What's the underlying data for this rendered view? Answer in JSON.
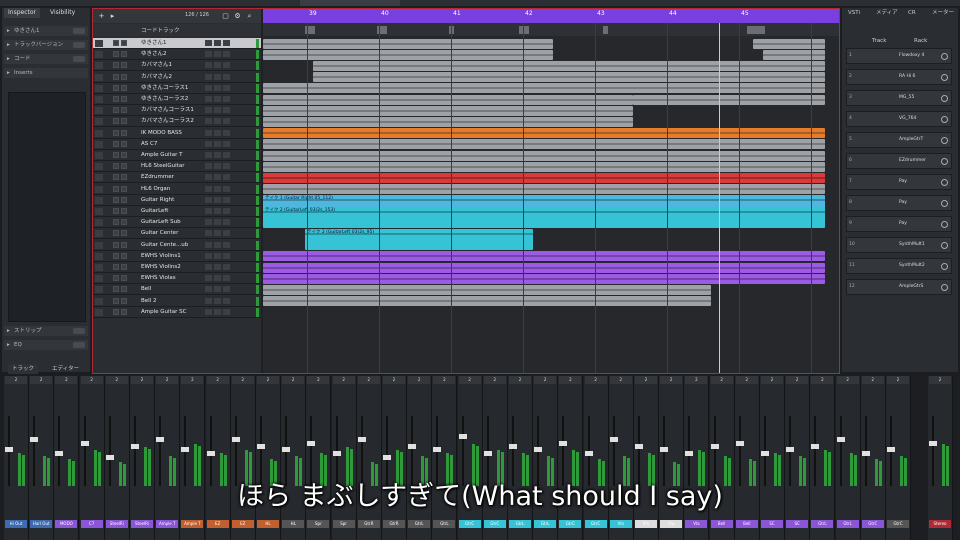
{
  "inspector": {
    "tabs": [
      "Inspector",
      "Visibility"
    ],
    "track_name": "ゆきさん1",
    "sections": [
      "トラックバージョン",
      "コード",
      "Inserts",
      "ストリップ",
      "EQ"
    ]
  },
  "bottom_tabs": [
    "トラック",
    "エディター"
  ],
  "tracklist": {
    "counter": "126 / 126",
    "chord_track": "コードトラック",
    "tracks": [
      {
        "name": "ゆきさん1",
        "selected": true
      },
      {
        "name": "ゆきさん2"
      },
      {
        "name": "カバマさん1"
      },
      {
        "name": "カバマさん2"
      },
      {
        "name": "ゆきさんコーラス1"
      },
      {
        "name": "ゆきさんコーラス2"
      },
      {
        "name": "カバマさんコーラス1"
      },
      {
        "name": "カバマさんコーラス2"
      },
      {
        "name": "IK MODO BASS"
      },
      {
        "name": "AS C7"
      },
      {
        "name": "Ample Guitar T"
      },
      {
        "name": "HL6 SteelGuitar"
      },
      {
        "name": "EZdrummer"
      },
      {
        "name": "HL6 Organ"
      },
      {
        "name": "Guitar Right"
      },
      {
        "name": "GuitarLeft"
      },
      {
        "name": "GuitarLeft Sub"
      },
      {
        "name": "Guitar Center"
      },
      {
        "name": "Guitar Cente...ub"
      },
      {
        "name": "EWHS Violins1"
      },
      {
        "name": "EWHS Violins2"
      },
      {
        "name": "EWHS Violas"
      },
      {
        "name": "Bell"
      },
      {
        "name": "Bell 2"
      },
      {
        "name": "Ample Guitar SC"
      }
    ]
  },
  "ruler": {
    "bars": [
      "39",
      "40",
      "41",
      "42",
      "43",
      "44",
      "45"
    ]
  },
  "clips": {
    "guitar_right": "テイク 1 (Guitar Right 05_112)",
    "guitar_left": "テイク 2 (GuitarLeft 03(2s_153)",
    "guitar_left_sub": "テイク 2 (GuitarLeft 03(2s_95)",
    "guitar_left_sub2": "テイク 2 (GuitarL"
  },
  "rack": {
    "tabs": [
      "VSTi",
      "メディア",
      "CR",
      "メーター"
    ],
    "track_label": "Track",
    "rack_label": "Rack",
    "slots": [
      "Flowdoxy 4",
      "RA Hi 6",
      "MG_55",
      "VG_764",
      "AmpleGtrT",
      "EZdrummer",
      "Pay",
      "Pay",
      "Pay",
      "SynthMuIt1",
      "SynthMuIt2",
      "AmpleGtrS"
    ]
  },
  "mixer": {
    "strip_count": 37,
    "bottom_labels": [
      "Hi Out",
      "Harl Out",
      "MODO",
      "C7",
      "SteelRi",
      "SteelRi",
      "Ample T",
      "Ample T",
      "EZ",
      "EZ",
      "HL",
      "HL",
      "Spr",
      "Spr",
      "GtrR",
      "GtrR",
      "GtrL",
      "GtrL",
      "GtrC",
      "GtrC",
      "GtrL",
      "GtrL",
      "GtrC",
      "GtrC",
      "Vln",
      "Vln",
      "Vla",
      "Vla",
      "Bell",
      "Bell",
      "SC",
      "SC",
      "GtrL",
      "GtrL",
      "GtrC",
      "GtrC",
      "Stereo"
    ]
  },
  "subtitle": "ほら まぶしすぎて(What should I say)",
  "colors": {
    "accent_red": "#b02a36",
    "ruler_purple": "#7a3fe0"
  }
}
